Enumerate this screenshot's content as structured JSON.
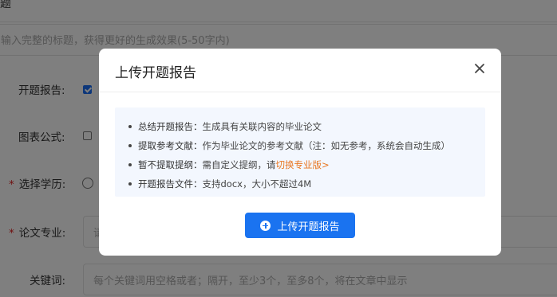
{
  "page": {
    "top_label": "题",
    "title_input_placeholder": "输入完整的标题，获得更好的生成效果(5-50字内)",
    "fields": {
      "proposal_report_label": "开题报告:",
      "chart_formula_label": "图表公式:",
      "degree_label": "选择学历:",
      "major_label": "论文专业:",
      "major_placeholder": "请",
      "keywords_label": "关键词:",
      "keywords_placeholder": "每个关键词用空格或者；隔开，至少3个，至多8个，将在文章中显示",
      "required_mark": "*"
    }
  },
  "modal": {
    "title": "上传开题报告",
    "items": [
      {
        "key": "总结开题报告：",
        "text": "生成具有关联内容的毕业论文"
      },
      {
        "key": "提取参考文献：",
        "text": "作为毕业论文的参考文献（注：如无参考，系统会自动生成）"
      },
      {
        "key": "暂不提取提纲：",
        "text": "需自定义提纲，请",
        "link": "切换专业版>"
      },
      {
        "key": "开题报告文件：",
        "text": "支持docx，大小不超过4M"
      }
    ],
    "upload_button_label": "上传开题报告"
  },
  "colors": {
    "accent": "#1a73f0",
    "link": "#e87722",
    "required": "#e02020",
    "overlay": "rgba(0,0,0,0.5)"
  },
  "icons": {
    "close": "close-icon",
    "upload": "plus-circle-icon"
  }
}
